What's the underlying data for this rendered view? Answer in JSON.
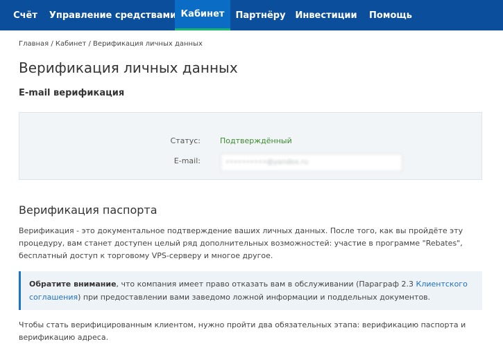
{
  "nav": {
    "items": [
      {
        "label": "Счёт"
      },
      {
        "label": "Управление средствами"
      },
      {
        "label": "Кабинет",
        "active": true
      },
      {
        "label": "Партнёру"
      },
      {
        "label": "Инвестиции"
      },
      {
        "label": "Помощь"
      }
    ],
    "bg_color": "#0b4f9c",
    "active_bg": "#0a6cc4",
    "active_underline": "#19b56b"
  },
  "breadcrumb": "Главная / Кабинет / Верификация личных данных",
  "page_title": "Верификация личных данных",
  "email_section": {
    "title": "E-mail верификация",
    "status_label": "Статус:",
    "status_value": "Подтверждённый",
    "status_color": "#3a8a2c",
    "email_label": "E-mail:",
    "email_value": "••••••••••@yandex.ru"
  },
  "passport_section": {
    "title": "Верификация паспорта",
    "intro": "Верификация - это документальное подтверждение ваших личных данных. После того, как вы пройдёте эту процедуру, вам станет доступен целый ряд дополнительных возможностей: участие в программе \"Rebates\", бесплатный доступ к торговому VPS-серверу и многое другое.",
    "notice": {
      "bold": "Обратите внимание",
      "text_before_link": ", что компания имеет право отказать вам в обслуживании (Параграф 2.3 ",
      "link_text": "Клиентского соглашения",
      "text_after_link": ") при предоставлении вами заведомо ложной информации и поддельных документов."
    },
    "outro": "Чтобы стать верифицированным клиентом, нужно пройти два обязательных этапа: верификацию паспорта и верификацию адреса."
  }
}
